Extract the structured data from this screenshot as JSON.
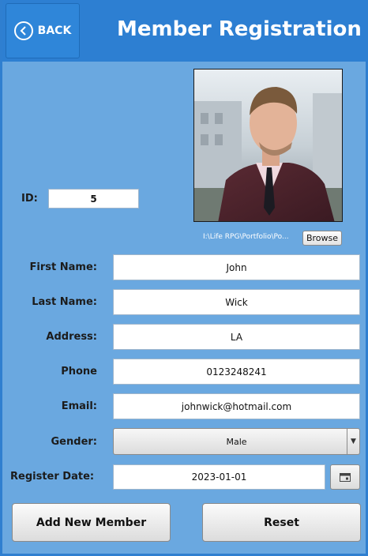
{
  "header": {
    "back_label": "BACK",
    "title": "Member Registration"
  },
  "photo": {
    "path": "I:\\Life RPG\\Portfolio\\Po...",
    "browse_label": "Browse"
  },
  "form": {
    "id_label": "ID:",
    "id_value": "5",
    "first_name_label": "First Name:",
    "first_name_value": "John",
    "last_name_label": "Last Name:",
    "last_name_value": "Wick",
    "address_label": "Address:",
    "address_value": "LA",
    "phone_label": "Phone",
    "phone_value": "0123248241",
    "email_label": "Email:",
    "email_value": "johnwick@hotmail.com",
    "gender_label": "Gender:",
    "gender_value": "Male",
    "register_date_label": "Register Date:",
    "register_date_value": "2023-01-01"
  },
  "actions": {
    "add_label": "Add New Member",
    "reset_label": "Reset"
  },
  "icons": {
    "back": "chevron-left-circle-icon",
    "calendar": "calendar-icon",
    "dropdown": "caret-down-icon"
  },
  "colors": {
    "header_bg": "#2d7fd2",
    "panel_bg": "#6aa8e0"
  }
}
